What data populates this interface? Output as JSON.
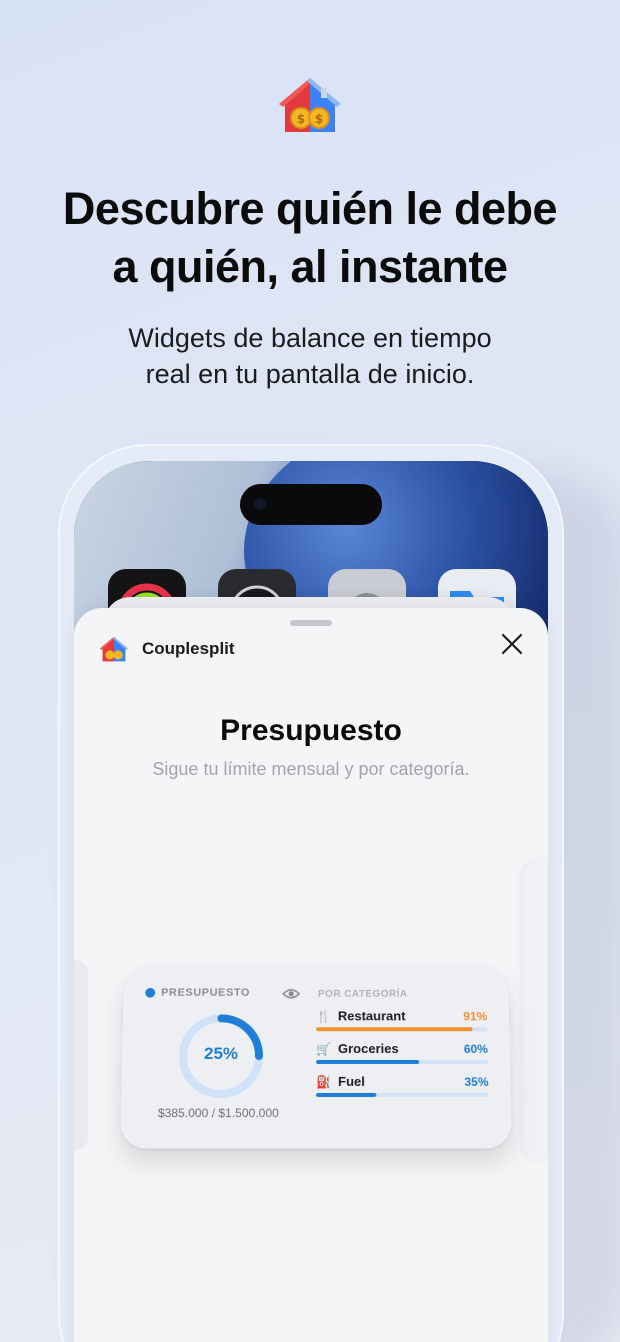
{
  "hero": {
    "icon": "house-coins-icon",
    "headline_line1": "Descubre quién le debe",
    "headline_line2": "a quién, al instante",
    "subline_line1": "Widgets de balance en tiempo",
    "subline_line2": "real en tu pantalla de inicio."
  },
  "sheet": {
    "app_name": "Couplesplit",
    "title": "Presupuesto",
    "subtitle": "Sigue tu límite mensual y por categoría.",
    "close_icon": "close-icon"
  },
  "widget": {
    "budget_label": "PRESUPUESTO",
    "percent_label": "25%",
    "percent_value": 0.25,
    "amount": "$385.000 / $1.500.000",
    "category_label": "POR CATEGORÍA",
    "categories": [
      {
        "emoji": "🍴",
        "name": "Restaurant",
        "pct_label": "91%",
        "pct": 0.91,
        "color": "#f0902f"
      },
      {
        "emoji": "🛒",
        "name": "Groceries",
        "pct_label": "60%",
        "pct": 0.6,
        "color": "#1f7fd6"
      },
      {
        "emoji": "⛽",
        "name": "Fuel",
        "pct_label": "35%",
        "pct": 0.35,
        "color": "#1f7fd6"
      }
    ]
  },
  "colors": {
    "accent": "#1f7fd6",
    "warning": "#f0902f",
    "house_red": "#e0393e",
    "house_blue": "#3b82f6",
    "coin_gold": "#f5b623"
  }
}
